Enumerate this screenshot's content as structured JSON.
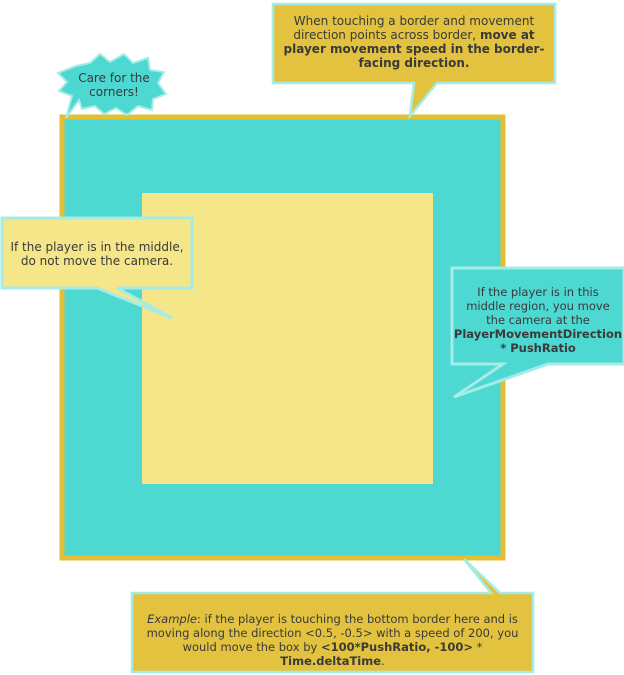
{
  "colors": {
    "outer_region": "#4dd8d2",
    "inner_region": "#f5e68a",
    "border": "#e2bf35",
    "callout_cyan": "#4dd8d2",
    "callout_yellow": "#f5e68a",
    "callout_gold": "#e2c23e",
    "callout_outline": "#a5ece6",
    "text": "#3a3a3a"
  },
  "callouts": {
    "top": {
      "line1": "When touching a border and movement",
      "line2_plain": "direction points across border, ",
      "line2_bold": "move at",
      "line3_bold": "player movement speed in the border-",
      "line4_bold": "facing direction."
    },
    "corners": {
      "line1": "Care for the",
      "line2": "corners!"
    },
    "middle": {
      "line1": "If the player is in the middle,",
      "line2": "do not move the camera."
    },
    "right": {
      "line1": "If the player is in this",
      "line2": "middle region, you move",
      "line3": "the camera at the",
      "line4_bold": "PlayerMovementDirection",
      "line5_bold": "* PushRatio"
    },
    "bottom": {
      "line1_italic": "Example",
      "line1_rest": ": if the player is touching the bottom border here and is",
      "line2": "moving along the direction <0.5, -0.5> with a speed of 200, you",
      "line3_plain": "would move the box by ",
      "line3_bold1": "<100*PushRatio, -100>",
      "line3_plain2": " * ",
      "line3_bold2": "Time.deltaTime",
      "line3_end": "."
    }
  }
}
